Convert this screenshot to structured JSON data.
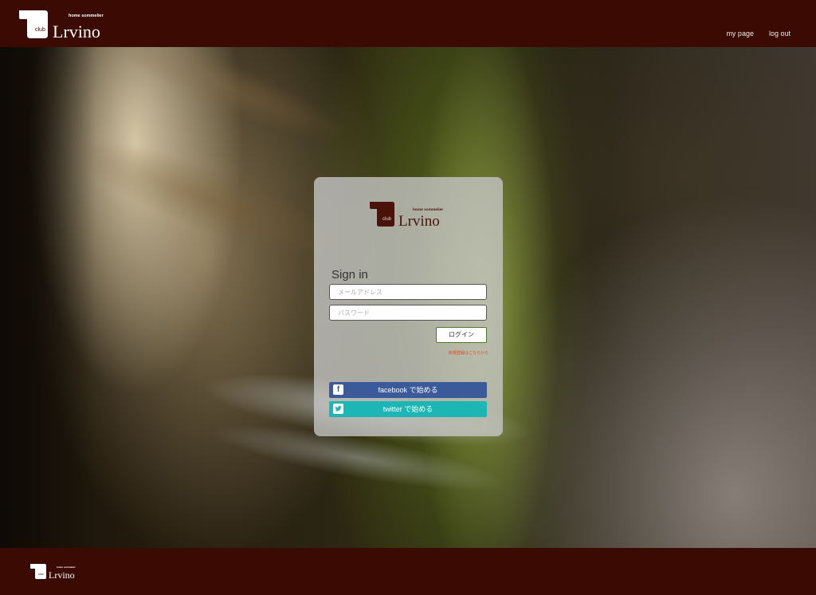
{
  "brand": {
    "club_text": "club",
    "tagline": "home sommelier",
    "name": "Lrvino"
  },
  "nav": {
    "my_page": "my page",
    "log_out": "log out"
  },
  "signin": {
    "title": "Sign in",
    "email_placeholder": "メールアドレス",
    "password_placeholder": "パスワード",
    "login_label": "ログイン",
    "register_link": "新規登録はこちらから",
    "facebook_label": "facebook で始める",
    "twitter_label": "twitter で始める"
  },
  "icons": {
    "facebook": "facebook-icon",
    "twitter": "twitter-icon"
  },
  "colors": {
    "header_bg": "#3a0a03",
    "facebook": "#3b5a9a",
    "twitter": "#1cb7b5",
    "login_border": "#4e7a23",
    "register_link": "#e04a2a"
  }
}
